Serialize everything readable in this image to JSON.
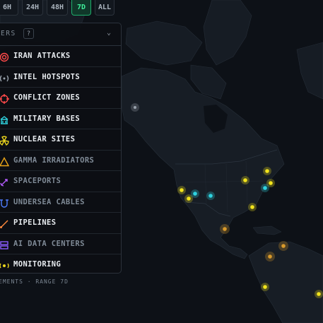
{
  "time_range": {
    "options": [
      "6H",
      "24H",
      "48H",
      "7D",
      "ALL"
    ],
    "active": "7D"
  },
  "panel": {
    "title": "ERS",
    "help_label": "?",
    "chevron_icon": "chevron-down-icon",
    "layers": [
      {
        "label": "IRAN ATTACKS",
        "icon": "target-icon",
        "color": "#ff4a4a",
        "enabled": true
      },
      {
        "label": "INTEL HOTSPOTS",
        "icon": "radio-signal-icon",
        "color": "#9aa3ad",
        "enabled": true
      },
      {
        "label": "CONFLICT ZONES",
        "icon": "crosshair-icon",
        "color": "#ff4a4a",
        "enabled": true
      },
      {
        "label": "MILITARY BASES",
        "icon": "building-icon",
        "color": "#2fd3e0",
        "enabled": true
      },
      {
        "label": "NUCLEAR SITES",
        "icon": "radiation-icon",
        "color": "#e8d31d",
        "enabled": true
      },
      {
        "label": "GAMMA IRRADIATORS",
        "icon": "warning-triangle-icon",
        "color": "#e8a317",
        "enabled": false
      },
      {
        "label": "SPACEPORTS",
        "icon": "rocket-icon",
        "color": "#b45cff",
        "enabled": false
      },
      {
        "label": "UNDERSEA CABLES",
        "icon": "cable-icon",
        "color": "#4f7dff",
        "enabled": false
      },
      {
        "label": "PIPELINES",
        "icon": "pipe-icon",
        "color": "#ff8a3d",
        "enabled": true
      },
      {
        "label": "AI DATA CENTERS",
        "icon": "server-icon",
        "color": "#8a5cff",
        "enabled": false
      },
      {
        "label": "MONITORING",
        "icon": "eye-signal-icon",
        "color": "#e8d31d",
        "enabled": true
      }
    ]
  },
  "status": {
    "text": "EMENTS · RANGE 7D"
  },
  "colors": {
    "background": "#0d1117",
    "land": "#171d25",
    "accent_active": "#3ff09b",
    "marker_yellow": "#f2e41c",
    "marker_cyan": "#2fd3e0",
    "marker_orange": "#d99a2b",
    "marker_grey": "#9aa3ad"
  },
  "markers": [
    {
      "type": "monitoring",
      "color": "yellow"
    },
    {
      "type": "monitoring",
      "color": "yellow"
    },
    {
      "type": "monitoring",
      "color": "yellow"
    },
    {
      "type": "monitoring",
      "color": "yellow"
    },
    {
      "type": "monitoring",
      "color": "yellow"
    },
    {
      "type": "monitoring",
      "color": "yellow"
    },
    {
      "type": "monitoring",
      "color": "yellow"
    },
    {
      "type": "monitoring",
      "color": "yellow"
    },
    {
      "type": "military",
      "color": "cyan"
    },
    {
      "type": "military",
      "color": "cyan"
    },
    {
      "type": "military",
      "color": "cyan"
    },
    {
      "type": "conflict",
      "color": "orange"
    },
    {
      "type": "conflict",
      "color": "orange"
    },
    {
      "type": "conflict",
      "color": "orange"
    },
    {
      "type": "intel",
      "color": "grey"
    }
  ]
}
